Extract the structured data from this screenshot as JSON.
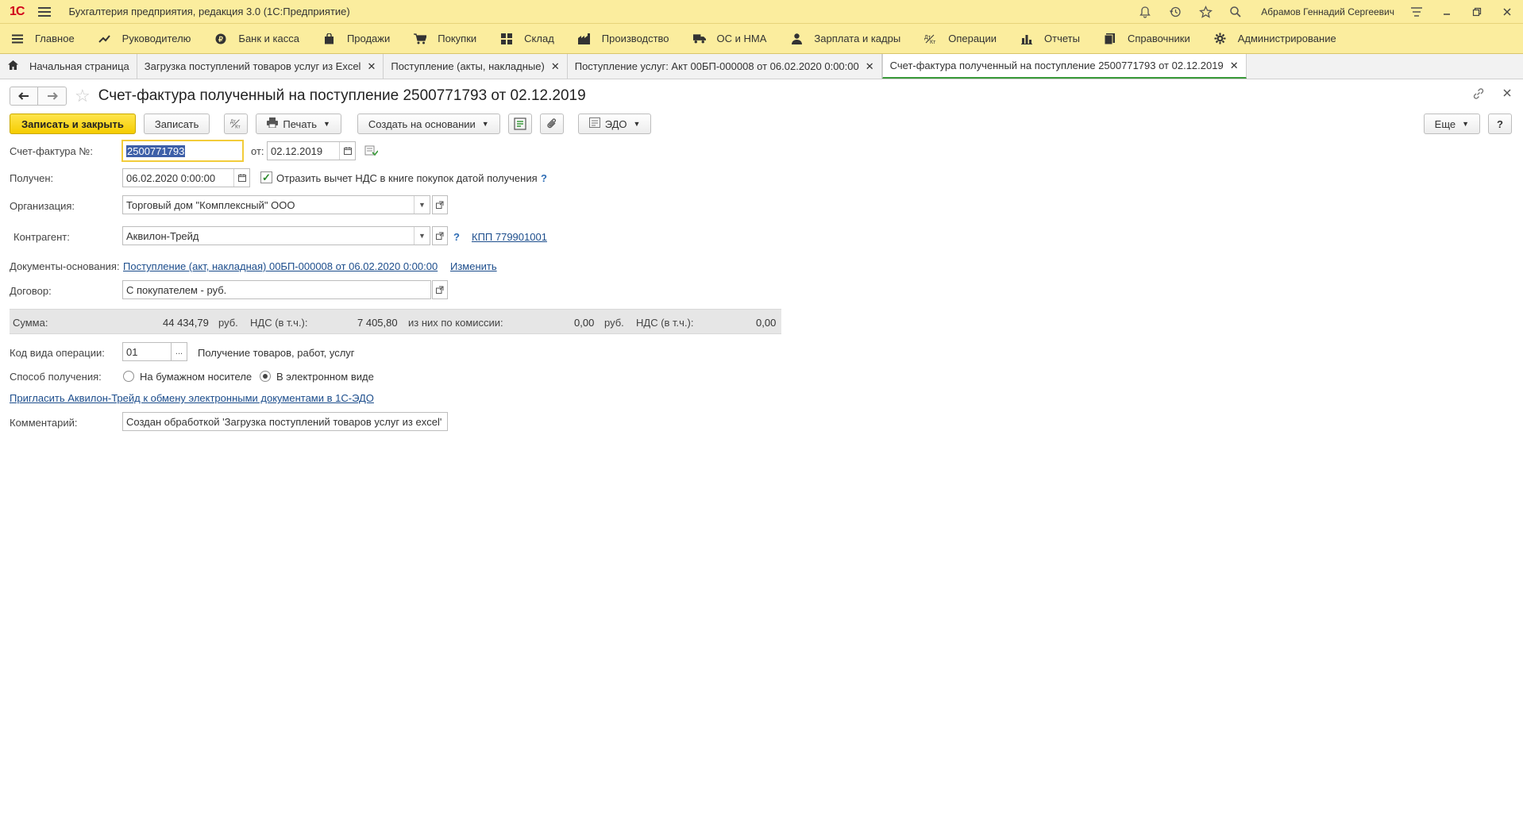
{
  "titlebar": {
    "logo": "1С",
    "title": "Бухгалтерия предприятия, редакция 3.0  (1С:Предприятие)",
    "user": "Абрамов Геннадий Сергеевич"
  },
  "sections": [
    {
      "label": "Главное",
      "icon": "menu-icon"
    },
    {
      "label": "Руководителю",
      "icon": "trend-icon"
    },
    {
      "label": "Банк и касса",
      "icon": "coin-icon"
    },
    {
      "label": "Продажи",
      "icon": "bag-icon"
    },
    {
      "label": "Покупки",
      "icon": "cart-icon"
    },
    {
      "label": "Склад",
      "icon": "warehouse-icon"
    },
    {
      "label": "Производство",
      "icon": "factory-icon"
    },
    {
      "label": "ОС и НМА",
      "icon": "truck-icon"
    },
    {
      "label": "Зарплата и кадры",
      "icon": "person-icon"
    },
    {
      "label": "Операции",
      "icon": "operations-icon"
    },
    {
      "label": "Отчеты",
      "icon": "chart-icon"
    },
    {
      "label": "Справочники",
      "icon": "book-icon"
    },
    {
      "label": "Администрирование",
      "icon": "gear-icon"
    }
  ],
  "tabs": [
    {
      "label": "Начальная страница"
    },
    {
      "label": "Загрузка поступлений товаров услуг из Excel"
    },
    {
      "label": "Поступление (акты, накладные)"
    },
    {
      "label": "Поступление услуг: Акт 00БП-000008 от 06.02.2020 0:00:00"
    },
    {
      "label": "Счет-фактура полученный на поступление 2500771793 от 02.12.2019"
    }
  ],
  "form": {
    "title": "Счет-фактура полученный на поступление 2500771793 от 02.12.2019"
  },
  "toolbar": {
    "save_close": "Записать и закрыть",
    "save": "Записать",
    "dtkt": "ДтКт",
    "print": "Печать",
    "create_based": "Создать на основании",
    "edo": "ЭДО",
    "more": "Еще",
    "help": "?"
  },
  "fields": {
    "invoice_no_label": "Счет-фактура №:",
    "invoice_no": "2500771793",
    "from_label": "от:",
    "invoice_date": "02.12.2019",
    "received_label": "Получен:",
    "received_date": "06.02.2020  0:00:00",
    "vat_check_label": "Отразить вычет НДС в книге покупок датой получения",
    "org_label": "Организация:",
    "org_value": "Торговый дом \"Комплексный\" ООО",
    "counterparty_label": "Контрагент:",
    "counterparty_value": "Аквилон-Трейд",
    "kpp_link": "КПП 779901001",
    "docs_label": "Документы-основания:",
    "docs_link": "Поступление (акт, накладная) 00БП-000008 от 06.02.2020 0:00:00",
    "docs_change": "Изменить",
    "contract_label": "Договор:",
    "contract_value": "С покупателем - руб.",
    "op_code_label": "Код вида операции:",
    "op_code_value": "01",
    "op_code_desc": "Получение товаров, работ, услуг",
    "method_label": "Способ получения:",
    "method_paper": "На бумажном носителе",
    "method_electronic": "В электронном виде",
    "invite_link": "Пригласить Аквилон-Трейд к обмену электронными документами в 1С-ЭДО",
    "comment_label": "Комментарий:",
    "comment_value": "Создан обработкой 'Загрузка поступлений товаров услуг из excel'"
  },
  "sum": {
    "label": "Сумма:",
    "amount": "44 434,79",
    "currency": "руб.",
    "vat_label": "НДС (в т.ч.):",
    "vat": "7 405,80",
    "commission_label": "из них по комиссии:",
    "commission": "0,00",
    "commission_currency": "руб.",
    "commission_vat_label": "НДС (в т.ч.):",
    "commission_vat": "0,00"
  },
  "ui_state": {
    "vat_checkbox_checked": true,
    "selected_method": "electronic"
  }
}
